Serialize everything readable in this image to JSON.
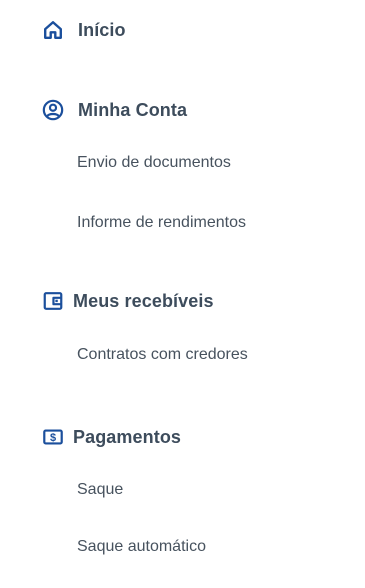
{
  "menu": {
    "accent_color": "#1b4f9c",
    "text_color": "#3d4c5c",
    "sections": [
      {
        "icon": "home-icon",
        "label": "Início",
        "items": []
      },
      {
        "icon": "user-circle-icon",
        "label": "Minha Conta",
        "items": [
          "Envio de documentos",
          "Informe de rendimentos"
        ]
      },
      {
        "icon": "wallet-icon",
        "label": "Meus recebíveis",
        "items": [
          "Contratos com credores"
        ]
      },
      {
        "icon": "money-icon",
        "label": "Pagamentos",
        "items": [
          "Saque",
          "Saque automático"
        ]
      }
    ]
  }
}
